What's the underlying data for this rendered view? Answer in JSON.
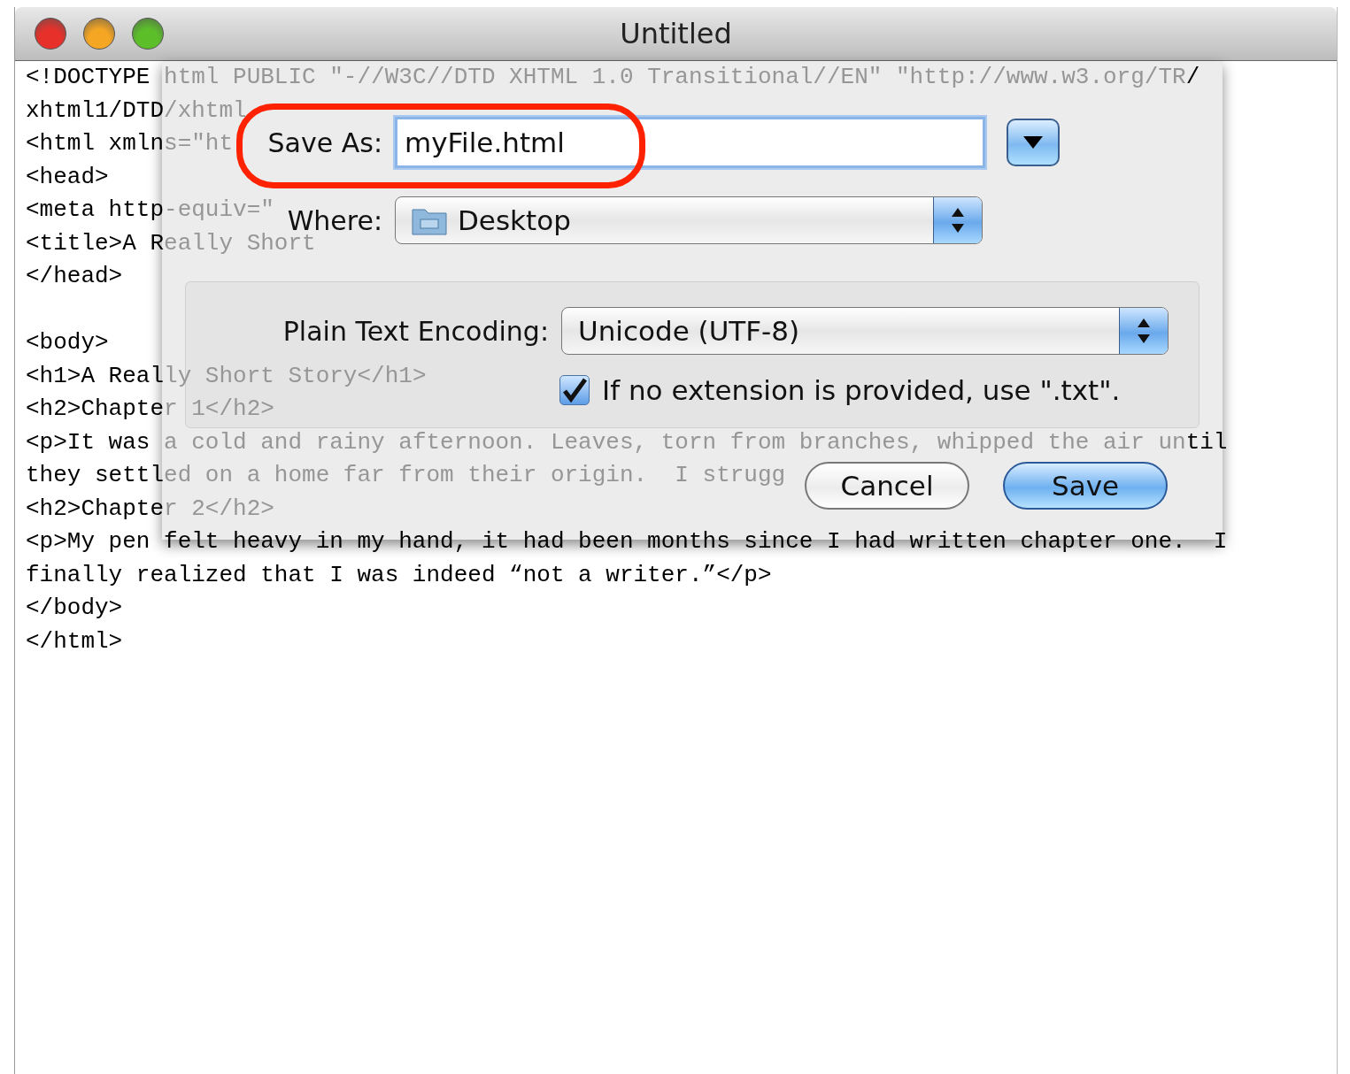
{
  "window": {
    "title": "Untitled"
  },
  "document": {
    "head_lines": [
      [
        {
          "text": "<!DOCTYPE",
          "faded": false
        },
        {
          "text": " html PUBLIC \"-//W3C//DTD XHTML 1.0 Transitional//EN\" \"http://www.w3.org/TR",
          "faded": true
        },
        {
          "text": "/",
          "faded": false
        }
      ],
      [
        {
          "text": "xhtml1/DTD",
          "faded": false
        },
        {
          "text": "/xhtml",
          "faded": true
        }
      ],
      [
        {
          "text": "<html xmln",
          "faded": false
        },
        {
          "text": "s=\"ht",
          "faded": true
        }
      ],
      [
        {
          "text": "<head>",
          "faded": false
        }
      ],
      [
        {
          "text": "<meta http",
          "faded": false
        },
        {
          "text": "-equiv=\"",
          "faded": true
        }
      ],
      [
        {
          "text": "<title>A R",
          "faded": false
        },
        {
          "text": "eally Short",
          "faded": true
        }
      ],
      [
        {
          "text": "</head>",
          "faded": false
        }
      ]
    ],
    "body_lines": [
      [
        {
          "text": "<body>",
          "faded": false
        }
      ],
      [
        {
          "text": "<h1>A Real",
          "faded": false
        },
        {
          "text": "ly Short Story</h1>",
          "faded": true
        }
      ],
      [
        {
          "text": "<h2>Chapte",
          "faded": false
        },
        {
          "text": "r 1</h2>",
          "faded": true
        }
      ],
      [
        {
          "text": "<p>It was ",
          "faded": false
        },
        {
          "text": "a cold and rainy afternoon. Leaves, torn from branches, whipped the air un",
          "faded": true
        },
        {
          "text": "til",
          "faded": false
        }
      ],
      [
        {
          "text": "they settl",
          "faded": false
        },
        {
          "text": "ed on a home far from their origin.  I strugg",
          "faded": true
        }
      ],
      [
        {
          "text": "<h2>Chapte",
          "faded": false
        },
        {
          "text": "r 2</h2>",
          "faded": true
        }
      ],
      [
        {
          "text": "<p>My pen felt heavy in my hand, it had been months since I had written chapter one.  I",
          "faded": false
        }
      ],
      [
        {
          "text": "finally realized that I was indeed “not a writer.”</p>",
          "faded": false
        }
      ],
      [
        {
          "text": "</body>",
          "faded": false
        }
      ],
      [
        {
          "text": "</html>",
          "faded": false
        }
      ]
    ]
  },
  "save_sheet": {
    "save_as": {
      "label": "Save As:",
      "value": "myFile.html",
      "highlighted": true
    },
    "where": {
      "label": "Where:",
      "value": "Desktop"
    },
    "encoding": {
      "label": "Plain Text Encoding:",
      "value": "Unicode (UTF-8)"
    },
    "extension_option": {
      "label": "If no extension is provided, use \".txt\".",
      "checked": true
    },
    "buttons": [
      {
        "label": "Cancel",
        "default": false
      },
      {
        "label": "Save",
        "default": true
      }
    ]
  }
}
